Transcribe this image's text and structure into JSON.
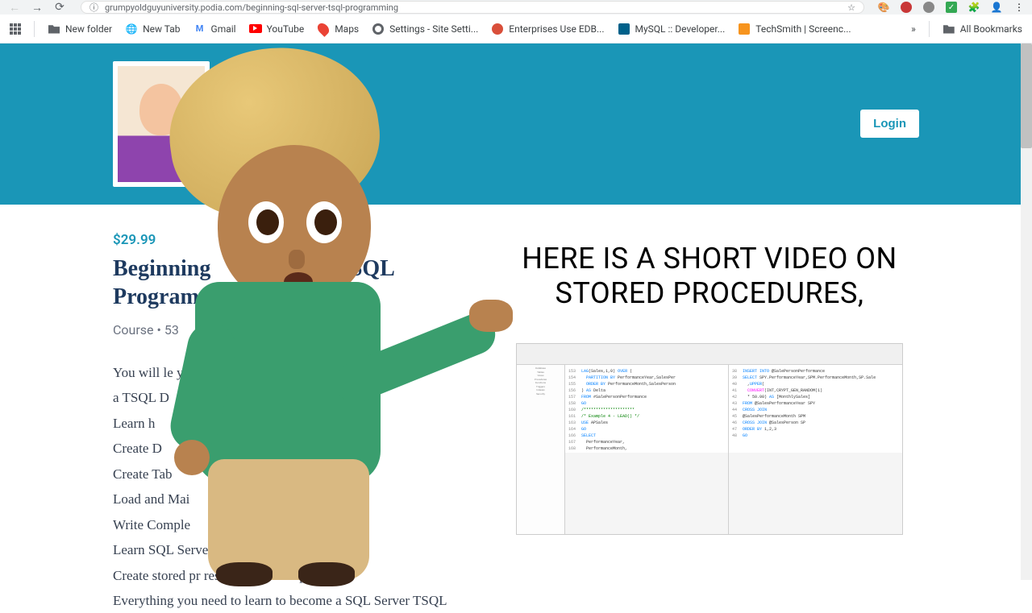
{
  "browser": {
    "url": "grumpyoldguyuniversity.podia.com/beginning-sql-server-tsql-programming",
    "bookmarks": [
      {
        "label": "New folder",
        "icon": "folder"
      },
      {
        "label": "New Tab",
        "icon": "globe"
      },
      {
        "label": "Gmail",
        "icon": "gmail"
      },
      {
        "label": "YouTube",
        "icon": "youtube"
      },
      {
        "label": "Maps",
        "icon": "maps"
      },
      {
        "label": "Settings - Site Setti...",
        "icon": "gear"
      },
      {
        "label": "Enterprises Use EDB...",
        "icon": "edb"
      },
      {
        "label": "MySQL :: Developer...",
        "icon": "mysql"
      },
      {
        "label": "TechSmith | Screenc...",
        "icon": "techsmith"
      }
    ],
    "all_bookmarks": "All Bookmarks"
  },
  "header": {
    "login": "Login"
  },
  "course": {
    "price": "$29.99",
    "title_part1": "Beginning ",
    "title_part2": " TSQL",
    "title_line2": "Program",
    "meta_type": "Course",
    "meta_sep": "  •  ",
    "meta_count": "53",
    "description": [
      "You will le                                              you to assume the role of",
      "a TSQL D",
      "Learn h",
      "Create D",
      "Create Tab",
      "Load and Mai",
      "Write Comple",
      "Learn SQL Serve               n fu",
      "Create stored pr            res and             batch script",
      "Everything you need to learn to become a SQL Server TSQL"
    ]
  },
  "video": {
    "caption_line1": "HERE IS A SHORT VIDEO ON",
    "caption_line2": "STORED PROCEDURES,"
  }
}
